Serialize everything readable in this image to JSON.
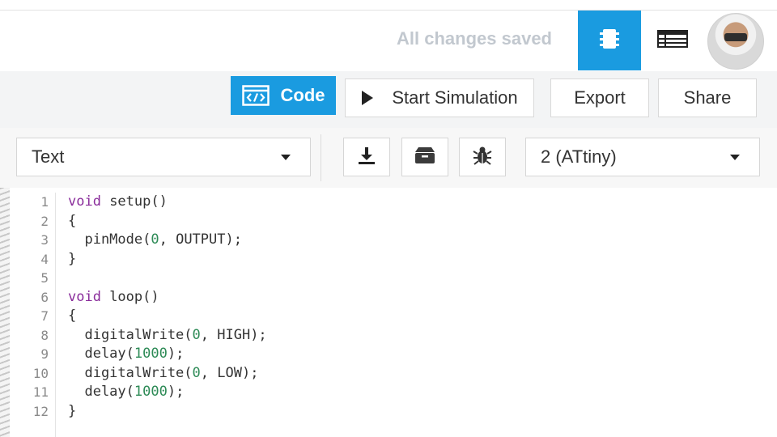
{
  "header": {
    "status_text": "All changes saved"
  },
  "toolbar": {
    "code_label": "Code",
    "simulation_label": "Start Simulation",
    "export_label": "Export",
    "share_label": "Share"
  },
  "editor_controls": {
    "mode_value": "Text",
    "board_value": "2 (ATtiny)"
  },
  "code": {
    "line_numbers": [
      "1",
      "2",
      "3",
      "4",
      "5",
      "6",
      "7",
      "8",
      "9",
      "10",
      "11",
      "12"
    ],
    "lines": [
      {
        "kw": "void",
        "rest": " setup()"
      },
      {
        "plain": "{"
      },
      {
        "pre": "  pinMode(",
        "num": "0",
        "post": ", OUTPUT);"
      },
      {
        "plain": "}"
      },
      {
        "plain": ""
      },
      {
        "kw": "void",
        "rest": " loop()"
      },
      {
        "plain": "{"
      },
      {
        "pre": "  digitalWrite(",
        "num": "0",
        "post": ", HIGH);"
      },
      {
        "pre": "  delay(",
        "num": "1000",
        "post": ");"
      },
      {
        "pre": "  digitalWrite(",
        "num": "0",
        "post": ", LOW);"
      },
      {
        "pre": "  delay(",
        "num": "1000",
        "post": ");"
      },
      {
        "plain": "}"
      }
    ]
  },
  "colors": {
    "accent": "#1a9be0",
    "keyword": "#8a2d9b",
    "number": "#2e8b57",
    "status_text": "#c2c8cf"
  },
  "icons": {
    "code": "code-window-icon",
    "simulation": "play-icon",
    "view1": "circuit-view-icon",
    "view2": "component-list-icon",
    "download": "download-icon",
    "libraries": "library-box-icon",
    "debugger": "bug-icon"
  }
}
